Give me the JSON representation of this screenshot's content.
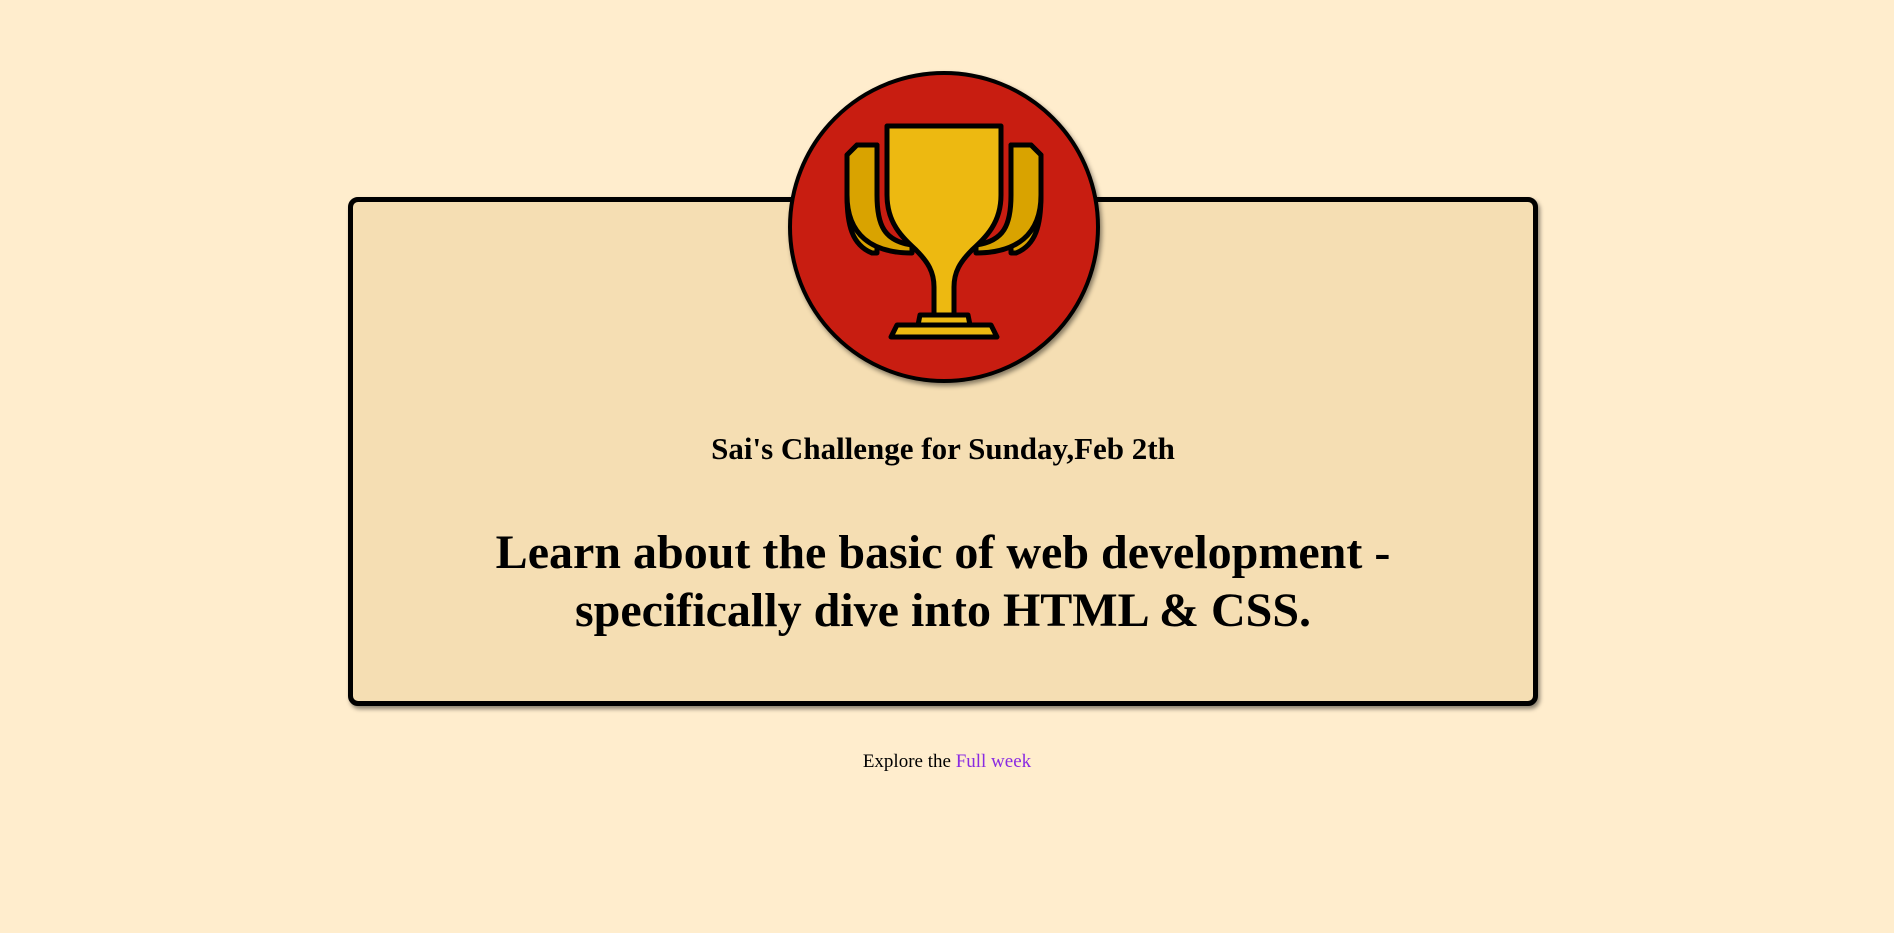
{
  "card": {
    "subtitle": "Sai's Challenge for Sunday,Feb 2th",
    "heading": "Learn about the basic of web development - specifically dive into HTML & CSS."
  },
  "badge": {
    "icon": "trophy-icon",
    "background_color": "#c81d11",
    "trophy_color": "#edb911"
  },
  "footer": {
    "prefix": "Explore the",
    "link_text": "Full week"
  },
  "colors": {
    "page_background": "#ffedcd",
    "card_background": "#f5deb3",
    "link": "#8a2be2"
  }
}
